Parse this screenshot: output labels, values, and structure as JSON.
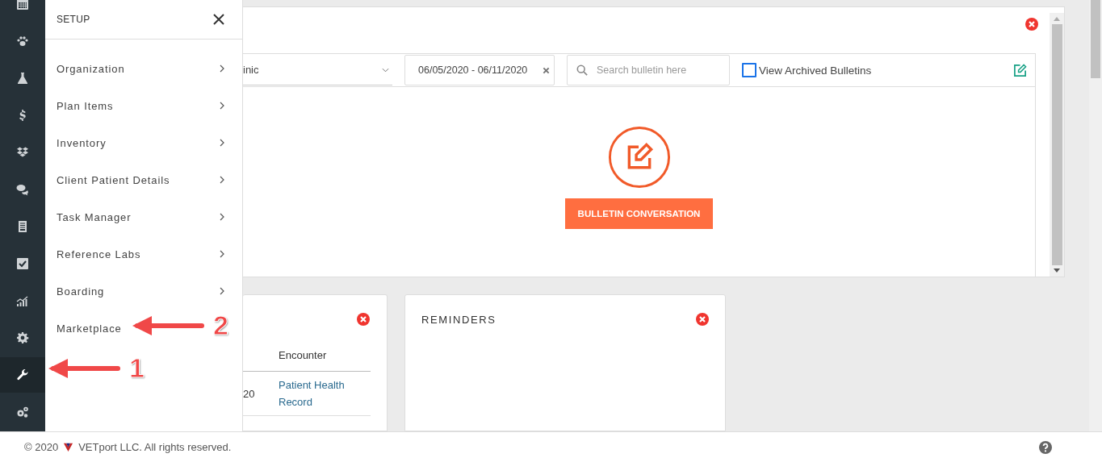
{
  "sidebar": {
    "items": [
      {
        "kind": "calendar",
        "selected": false
      },
      {
        "kind": "paw",
        "selected": false
      },
      {
        "kind": "flask",
        "selected": false
      },
      {
        "kind": "dollar",
        "selected": false
      },
      {
        "kind": "boxes",
        "selected": false
      },
      {
        "kind": "chat",
        "selected": false
      },
      {
        "kind": "document",
        "selected": false
      },
      {
        "kind": "checkbox",
        "selected": false
      },
      {
        "kind": "chart",
        "selected": false
      },
      {
        "kind": "gear",
        "selected": false
      },
      {
        "kind": "wrench",
        "selected": true
      },
      {
        "kind": "gears",
        "selected": false
      }
    ]
  },
  "setup_menu": {
    "title": "SETUP",
    "items": [
      {
        "label": "Organization",
        "kind": "submenu"
      },
      {
        "label": "Plan Items",
        "kind": "submenu"
      },
      {
        "label": "Inventory",
        "kind": "submenu"
      },
      {
        "label": "Client Patient Details",
        "kind": "submenu"
      },
      {
        "label": "Task Manager",
        "kind": "submenu"
      },
      {
        "label": "Reference Labs",
        "kind": "submenu"
      },
      {
        "label": "Boarding",
        "kind": "submenu"
      },
      {
        "label": "Marketplace",
        "kind": "link"
      }
    ]
  },
  "bulletin": {
    "clinic_select": {
      "value": "inic"
    },
    "date_range": {
      "value": "06/05/2020 - 06/11/2020"
    },
    "search": {
      "placeholder": "Search bulletin here"
    },
    "archived": {
      "label": "View Archived Bulletins",
      "checked": false
    },
    "action": "BULLETIN CONVERSATION"
  },
  "encounter_card": {
    "column": "Encounter",
    "row": {
      "cell": "20",
      "link": "Patient Health Record"
    }
  },
  "reminders_card": {
    "title": "REMINDERS"
  },
  "footer": {
    "year": "© 2020",
    "company": "VETport LLC. All rights reserved."
  },
  "annotations": [
    {
      "label": "1"
    },
    {
      "label": "2"
    }
  ]
}
